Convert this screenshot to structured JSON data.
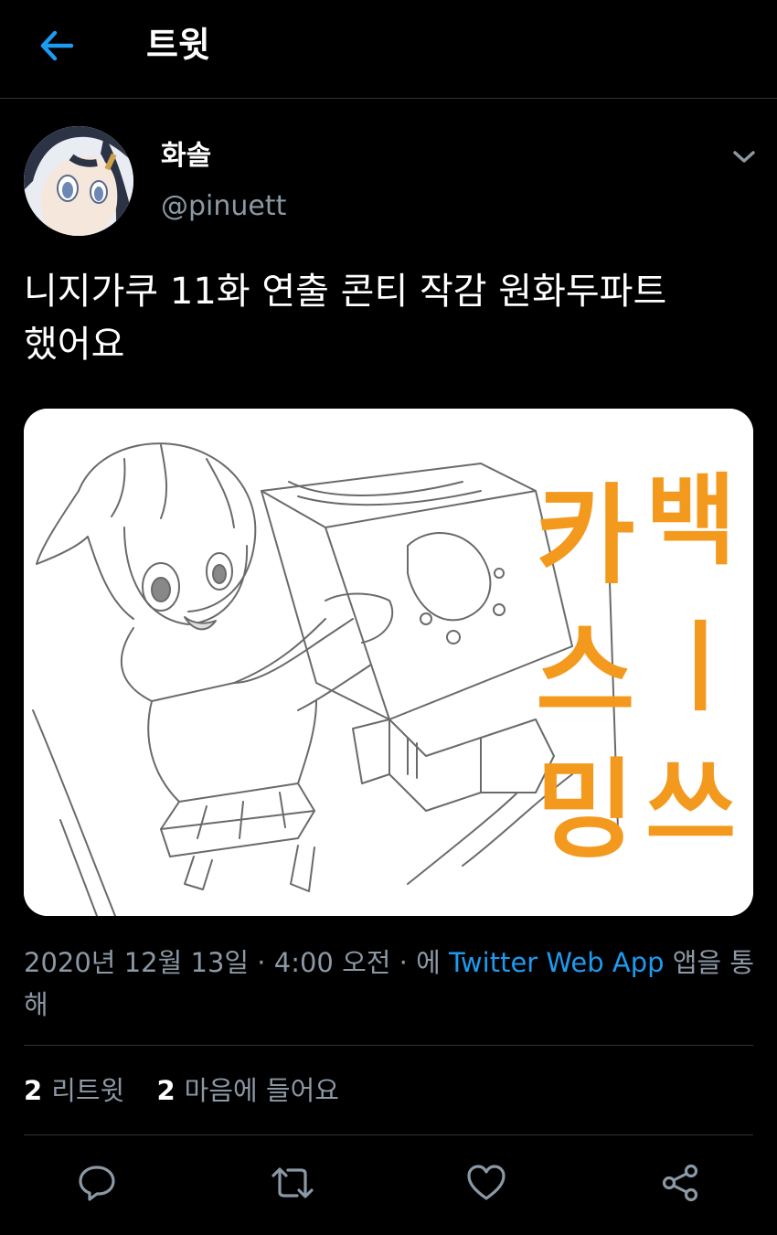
{
  "header": {
    "title": "트윗",
    "back_icon": "arrow-left-icon",
    "accent": "#1d9bf0"
  },
  "tweet": {
    "author": {
      "display_name": "화솔",
      "handle": "@pinuett"
    },
    "text_line1": "니지가쿠 11화 연출 콘티 작감 원화두파트",
    "text_line2": "했어요",
    "media": {
      "caption_chars": [
        "카",
        "백",
        "스",
        "ㅣ",
        "밍",
        "쓰"
      ],
      "caption_color": "#f39a1e"
    },
    "meta": {
      "date": "2020년 12월 13일",
      "sep1": " · ",
      "time": "4:00 오전",
      "sep2": " · ",
      "via_prefix": "에 ",
      "source": "Twitter Web App",
      "via_suffix": " 앱을 통해"
    },
    "stats": {
      "retweets_count": "2",
      "retweets_label": "리트윗",
      "likes_count": "2",
      "likes_label": "마음에 들어요"
    }
  },
  "actions": [
    "reply-icon",
    "retweet-icon",
    "like-icon",
    "share-icon"
  ]
}
